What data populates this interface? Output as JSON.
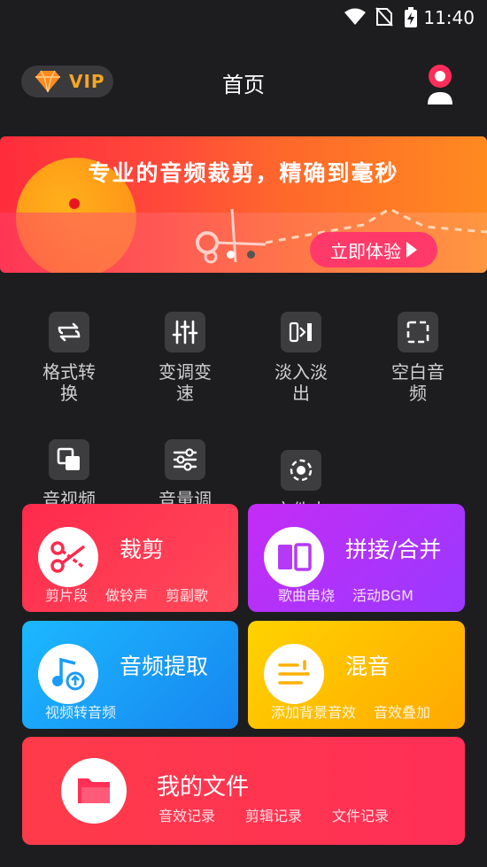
{
  "status_bar": {
    "time": "11:40"
  },
  "header": {
    "vip_label": "VIP",
    "title": "首页"
  },
  "banner": {
    "headline": "专业的音频裁剪，精确到毫秒",
    "cta_label": "立即体验"
  },
  "tools": [
    {
      "label_line1": "格式转",
      "label_line2": "换",
      "icon": "format-convert-icon"
    },
    {
      "label_line1": "变调变",
      "label_line2": "速",
      "icon": "pitch-speed-icon"
    },
    {
      "label_line1": "淡入淡",
      "label_line2": "出",
      "icon": "fade-icon"
    },
    {
      "label_line1": "空白音",
      "label_line2": "频",
      "icon": "blank-audio-icon"
    },
    {
      "label_line1": "音视频",
      "label_line2": "",
      "icon": "av-merge-icon"
    },
    {
      "label_line1": "音量调",
      "label_line2": "",
      "icon": "volume-adjust-icon"
    },
    {
      "label_line1": "文件夹",
      "label_line2": "",
      "icon": "record-icon"
    }
  ],
  "cards": {
    "cut": {
      "title": "裁剪",
      "subs": [
        "剪片段",
        "做铃声",
        "剪副歌"
      ]
    },
    "merge": {
      "title": "拼接/合并",
      "subs": [
        "歌曲串烧",
        "活动BGM"
      ]
    },
    "extract": {
      "title": "音频提取",
      "subs": [
        "视频转音频"
      ]
    },
    "mix": {
      "title": "混音",
      "subs": [
        "添加背景音效",
        "音效叠加"
      ]
    },
    "files": {
      "title": "我的文件",
      "subs": [
        "音效记录",
        "剪辑记录",
        "文件记录"
      ]
    }
  },
  "colors": {
    "background": "#1d1d1f",
    "accent_red": "#ff2d3d",
    "vip_gold": "#f5a623"
  }
}
